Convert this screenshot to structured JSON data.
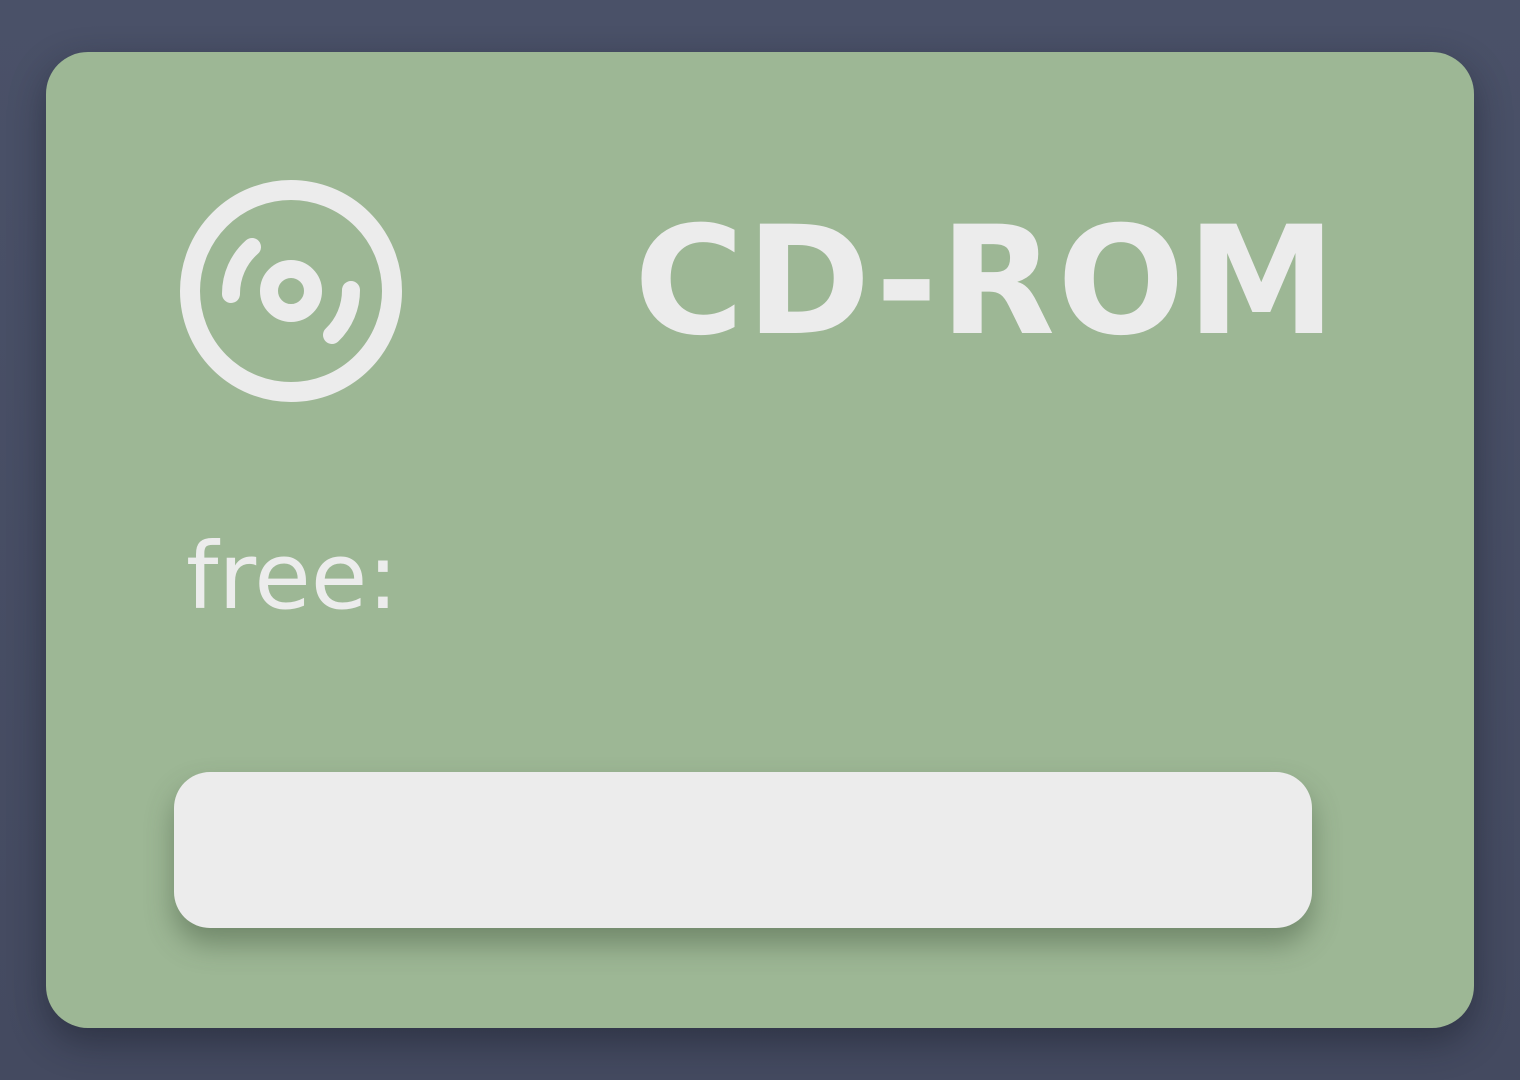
{
  "device": {
    "title": "CD-ROM",
    "icon": "disc-icon",
    "free_label": "free:",
    "free_value": "",
    "usage_fraction": 0
  },
  "colors": {
    "background": "#4a5167",
    "card": "#9db795",
    "foreground": "#ececec"
  }
}
